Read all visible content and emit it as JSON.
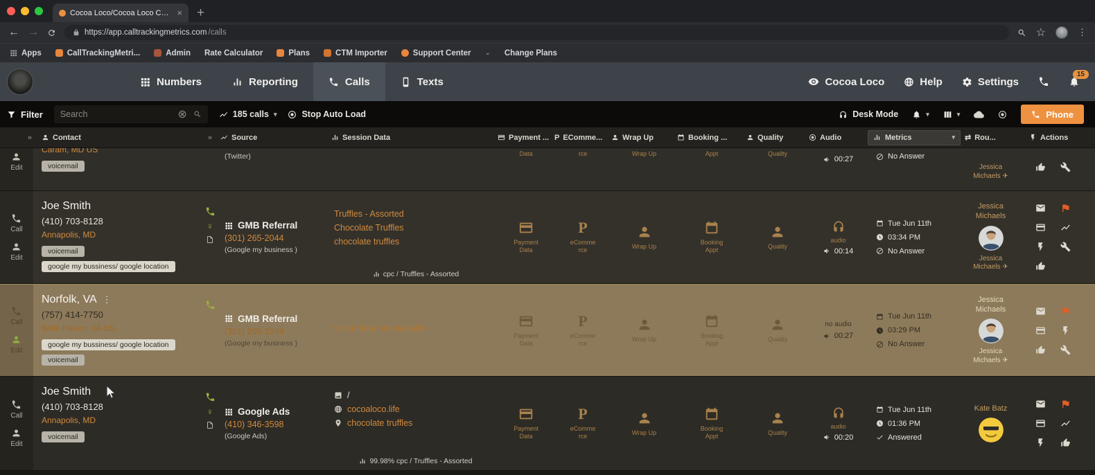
{
  "browser": {
    "tab": {
      "title": "Cocoa Loco/Cocoa Loco Call L"
    },
    "url": {
      "host": "https://app.calltrackingmetrics.com",
      "path": "/calls"
    },
    "bookmarks": [
      {
        "label": "Apps"
      },
      {
        "label": "CallTrackingMetri..."
      },
      {
        "label": "Admin"
      },
      {
        "label": "Rate Calculator"
      },
      {
        "label": "Plans"
      },
      {
        "label": "CTM Importer"
      },
      {
        "label": "Support Center"
      },
      {
        "label": "Change Plans"
      }
    ]
  },
  "nav": {
    "tabs": [
      {
        "label": "Numbers"
      },
      {
        "label": "Reporting"
      },
      {
        "label": "Calls"
      },
      {
        "label": "Texts"
      }
    ],
    "account": "Cocoa Loco",
    "help": "Help",
    "settings": "Settings",
    "badge": "15"
  },
  "filterbar": {
    "filter": "Filter",
    "search_placeholder": "Search",
    "calls_count": "185 calls",
    "stop_auto_load": "Stop Auto Load",
    "desk_mode": "Desk Mode",
    "phone": "Phone"
  },
  "table": {
    "headers": {
      "contact": "Contact",
      "source": "Source",
      "session": "Session Data",
      "payment": "Payment ...",
      "ecommerce": "EComme...",
      "wrapup": "Wrap Up",
      "booking": "Booking ...",
      "quality": "Quality",
      "audio": "Audio",
      "metrics": "Metrics",
      "routing": "Rou...",
      "actions": "Actions"
    },
    "labels": {
      "call": "Call",
      "edit": "Edit",
      "payment": "Payment Data",
      "ecommerce": "eComme rce",
      "wrapup": "Wrap Up",
      "booking": "Booking Appt",
      "quality": "Quality",
      "audio": "audio"
    }
  },
  "rows": [
    {
      "contact": {
        "location": "Caram, MD US"
      },
      "tags": {
        "voicemail": "voicemail"
      },
      "source": {
        "detail": "(Twitter)"
      },
      "labels": {
        "payment": "Data",
        "ecommerce": "rce",
        "wrapup": "Wrap Up",
        "booking": "Appt",
        "quality": "Quality"
      },
      "audio": {
        "duration": "00:27"
      },
      "metrics": {
        "status": "No Answer"
      },
      "agent": {
        "secondary": "Jessica Michaels ✈"
      }
    },
    {
      "contact": {
        "name": "Joe Smith",
        "phone": "(410) 703-8128",
        "location": "Annapolis, MD"
      },
      "tags": {
        "voicemail": "voicemail",
        "gmb": "google my bussiness/ google location"
      },
      "source": {
        "name": "GMB Referral",
        "number": "(301) 265-2044",
        "detail": "(Google my business )"
      },
      "session": {
        "line1": "Truffles - Assorted",
        "line2": "Chocolate Truffles",
        "line3": "chocolate truffles",
        "footer": "cpc / Truffles - Assorted"
      },
      "audio": {
        "duration": "00:14"
      },
      "metrics": {
        "date": "Tue Jun 11th",
        "time": "03:34 PM",
        "status": "No Answer"
      },
      "agent": {
        "name": "Jessica Michaels",
        "secondary": "Jessica Michaels ✈"
      }
    },
    {
      "contact": {
        "name": "Norfolk, VA",
        "phone": "(757) 414-7750",
        "location": "Belle Haven, VA US"
      },
      "tags": {
        "gmb": "google my bussiness/ google location",
        "voicemail": "voicemail"
      },
      "source": {
        "name": "GMB Referral",
        "number": "(301) 265-2044",
        "detail": "(Google my business )"
      },
      "session": {
        "note": "visitor data not available"
      },
      "audio": {
        "label": "no audio",
        "duration": "00:27"
      },
      "metrics": {
        "date": "Tue Jun 11th",
        "time": "03:29 PM",
        "status": "No Answer"
      },
      "agent": {
        "name": "Jessica Michaels",
        "secondary": "Jessica Michaels ✈"
      }
    },
    {
      "contact": {
        "name": "Joe Smith",
        "phone": "(410) 703-8128",
        "location": "Annapolis, MD"
      },
      "tags": {
        "voicemail": "voicemail"
      },
      "source": {
        "name": "Google Ads",
        "number": "(410) 346-3598",
        "detail": "(Google Ads)"
      },
      "session": {
        "image_path": "/",
        "site": "cocoaloco.life",
        "keyword": "chocolate truffles",
        "footer": "99.98% cpc / Truffles - Assorted"
      },
      "audio": {
        "duration": "00:20"
      },
      "metrics": {
        "date": "Tue Jun 11th",
        "time": "01:36 PM",
        "status": "Answered"
      },
      "agent": {
        "name": "Kate Batz"
      }
    }
  ]
}
